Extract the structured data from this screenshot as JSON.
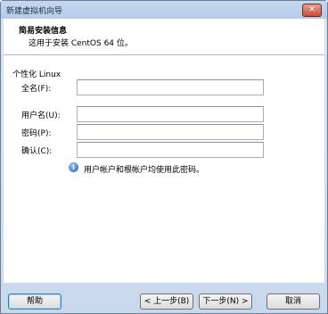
{
  "window": {
    "title": "新建虚拟机向导",
    "close_label": "✕"
  },
  "header": {
    "title": "简易安装信息",
    "subtitle": "这用于安装 CentOS 64 位。"
  },
  "section": {
    "title": "个性化 Linux"
  },
  "fields": {
    "fullname": {
      "label": "全名(F):",
      "value": ""
    },
    "username": {
      "label": "用户名(U):",
      "value": ""
    },
    "password": {
      "label": "密码(P):",
      "value": ""
    },
    "confirm": {
      "label": "确认(C):",
      "value": ""
    }
  },
  "info": {
    "text": "用户帐户和根帐户均使用此密码。",
    "icon": "info-icon"
  },
  "buttons": {
    "help": "帮助",
    "back": "< 上一步(B)",
    "next": "下一步(N) >",
    "cancel": "取消"
  }
}
